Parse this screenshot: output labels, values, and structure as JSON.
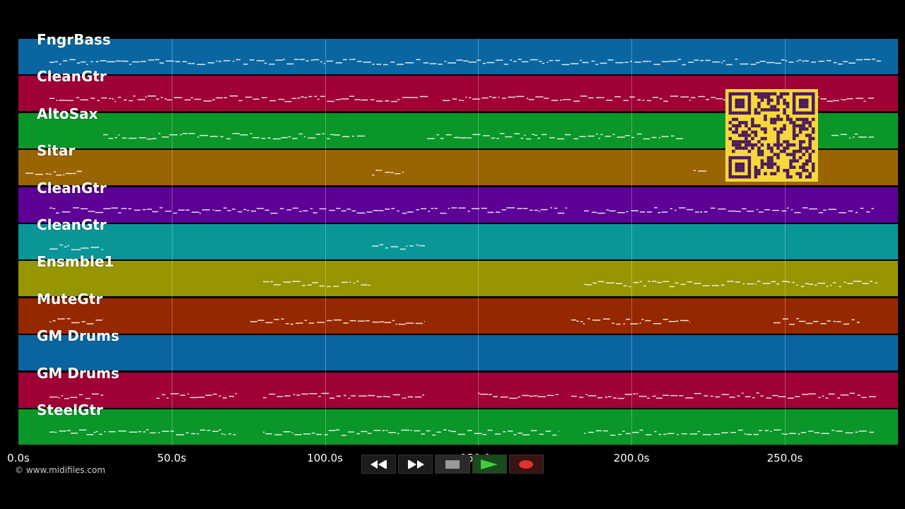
{
  "tracks": [
    {
      "name": "FngrBass",
      "color": "#0a66a0"
    },
    {
      "name": "CleanGtr",
      "color": "#9e0037"
    },
    {
      "name": "AltoSax",
      "color": "#0a9628"
    },
    {
      "name": "Sitar",
      "color": "#9a6400"
    },
    {
      "name": "CleanGtr",
      "color": "#5c0096"
    },
    {
      "name": "CleanGtr",
      "color": "#0a9696"
    },
    {
      "name": "Ensmble1",
      "color": "#969600"
    },
    {
      "name": "MuteGtr",
      "color": "#962800"
    },
    {
      "name": "GM Drums",
      "color": "#0a64a0"
    },
    {
      "name": "GM Drums",
      "color": "#9e0037"
    },
    {
      "name": "SteelGtr",
      "color": "#0a9628"
    }
  ],
  "timeline": {
    "ticks": [
      "0.0s",
      "50.0s",
      "100.0s",
      "150.0s",
      "200.0s",
      "250.0s"
    ]
  },
  "copyright": "© www.midifiles.com",
  "transport": {
    "buttons": [
      {
        "name": "rewind-button",
        "icon": "rewind-icon"
      },
      {
        "name": "fast-forward-button",
        "icon": "fast-forward-icon"
      },
      {
        "name": "stop-button",
        "icon": "stop-icon"
      },
      {
        "name": "play-button",
        "icon": "play-icon"
      },
      {
        "name": "record-button",
        "icon": "record-icon"
      }
    ]
  }
}
